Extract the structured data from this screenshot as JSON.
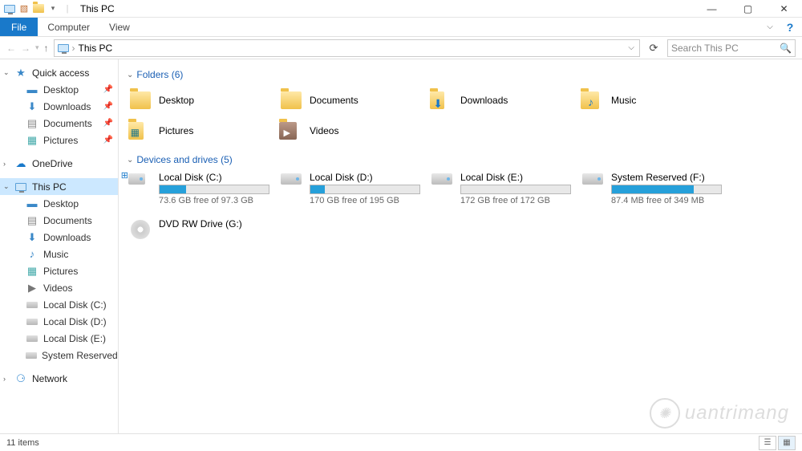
{
  "titlebar": {
    "title": "This PC"
  },
  "ribbon": {
    "file": "File",
    "computer": "Computer",
    "view": "View"
  },
  "address": {
    "location": "This PC",
    "search_placeholder": "Search This PC"
  },
  "nav": {
    "quick": {
      "label": "Quick access",
      "items": [
        {
          "label": "Desktop",
          "pinned": true
        },
        {
          "label": "Downloads",
          "pinned": true
        },
        {
          "label": "Documents",
          "pinned": true
        },
        {
          "label": "Pictures",
          "pinned": true
        }
      ]
    },
    "onedrive": {
      "label": "OneDrive"
    },
    "thispc": {
      "label": "This PC",
      "items": [
        {
          "label": "Desktop"
        },
        {
          "label": "Documents"
        },
        {
          "label": "Downloads"
        },
        {
          "label": "Music"
        },
        {
          "label": "Pictures"
        },
        {
          "label": "Videos"
        },
        {
          "label": "Local Disk (C:)"
        },
        {
          "label": "Local Disk (D:)"
        },
        {
          "label": "Local Disk (E:)"
        },
        {
          "label": "System Reserved (F:)"
        }
      ]
    },
    "network": {
      "label": "Network"
    }
  },
  "groups": {
    "folders": {
      "header": "Folders (6)",
      "items": [
        {
          "label": "Desktop"
        },
        {
          "label": "Documents"
        },
        {
          "label": "Downloads"
        },
        {
          "label": "Music"
        },
        {
          "label": "Pictures"
        },
        {
          "label": "Videos"
        }
      ]
    },
    "drives": {
      "header": "Devices and drives (5)",
      "items": [
        {
          "label": "Local Disk (C:)",
          "free": "73.6 GB free of 97.3 GB",
          "pct": 24
        },
        {
          "label": "Local Disk (D:)",
          "free": "170 GB free of 195 GB",
          "pct": 13
        },
        {
          "label": "Local Disk (E:)",
          "free": "172 GB free of 172 GB",
          "pct": 0
        },
        {
          "label": "System Reserved (F:)",
          "free": "87.4 MB free of 349 MB",
          "pct": 75
        },
        {
          "label": "DVD RW Drive (G:)",
          "optical": true
        }
      ]
    }
  },
  "status": {
    "items": "11 items"
  },
  "watermark": "uantrimang"
}
